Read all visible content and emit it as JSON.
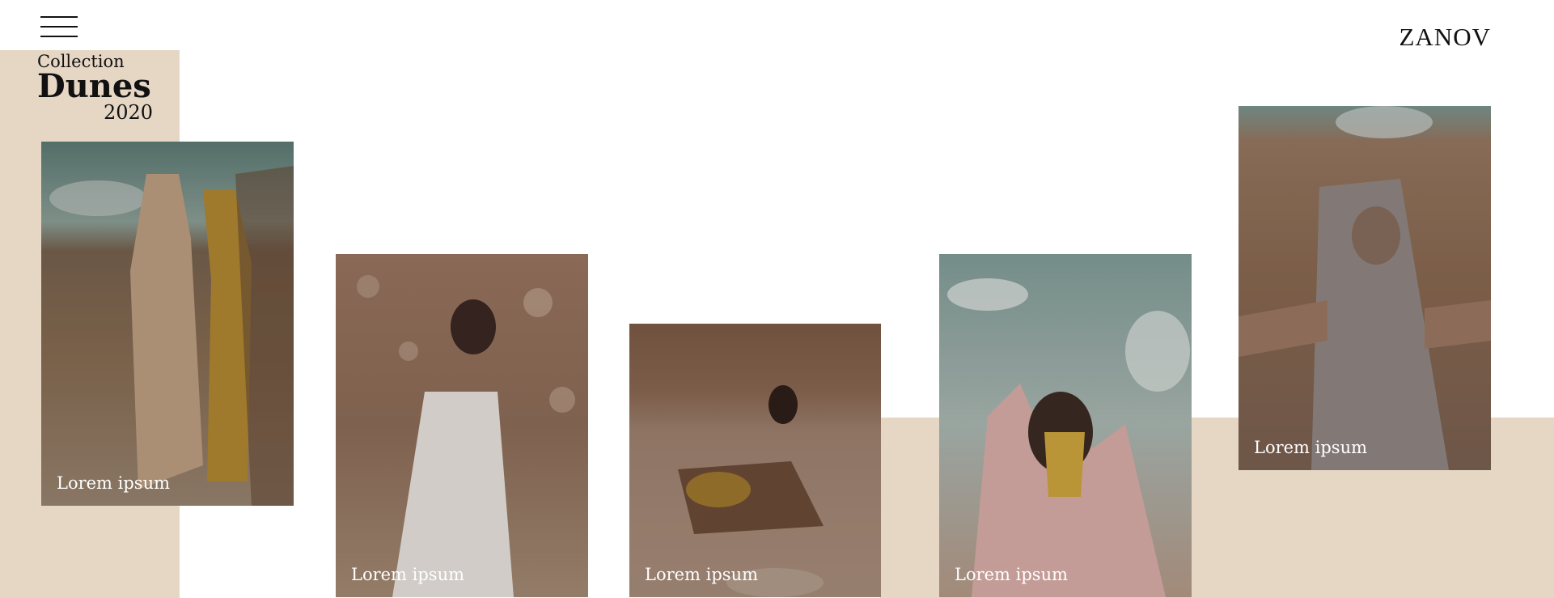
{
  "header": {
    "brand": "ZANOV",
    "menu_icon": "hamburger-menu-icon"
  },
  "collection": {
    "label": "Collection",
    "name": "Dunes",
    "year": "2020"
  },
  "cards": [
    {
      "label": "Lorem ipsum"
    },
    {
      "label": "Lorem ipsum"
    },
    {
      "label": "Lorem ipsum"
    },
    {
      "label": "Lorem ipsum"
    },
    {
      "label": "Lorem ipsum"
    }
  ],
  "colors": {
    "accent_beige": "#e6d6c4",
    "text_dark": "#111111",
    "caption_text": "#ffffff"
  }
}
